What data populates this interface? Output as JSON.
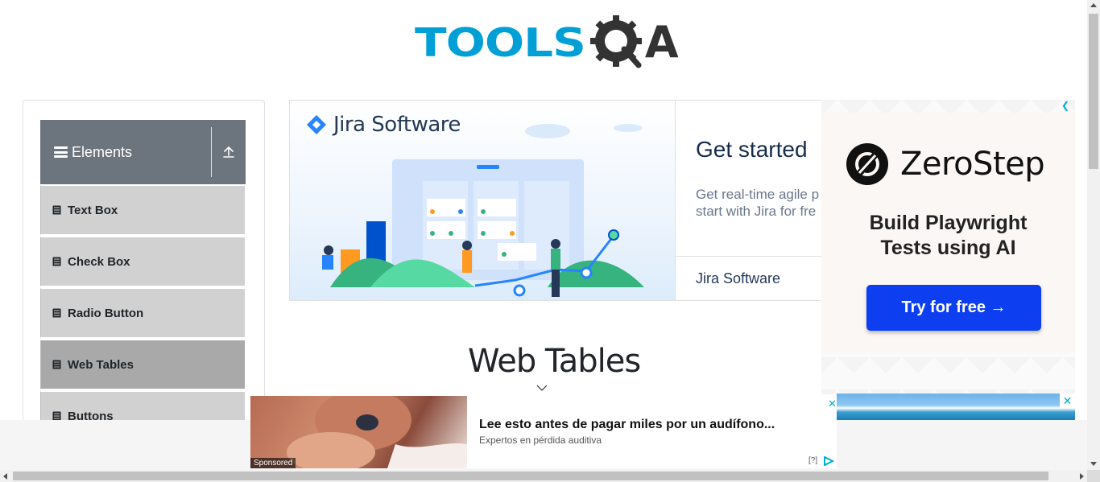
{
  "header": {
    "logo_text": "TOOLS",
    "logo_suffix": "A",
    "logo_icon": "gear-magnifier-icon"
  },
  "sidebar": {
    "group_title": "Elements",
    "group_icon": "hamburger-icon",
    "collapse_icon": "upload-arrow-icon",
    "items": [
      {
        "label": "Text Box",
        "icon": "file-icon"
      },
      {
        "label": "Check Box",
        "icon": "file-icon"
      },
      {
        "label": "Radio Button",
        "icon": "file-icon"
      },
      {
        "label": "Web Tables",
        "icon": "file-icon",
        "active": true
      },
      {
        "label": "Buttons",
        "icon": "file-icon"
      }
    ]
  },
  "ads": {
    "jira": {
      "brand": "Jira Software",
      "headline": "Get started",
      "sub_line1": "Get real-time agile p",
      "sub_line2": "start with Jira for fre",
      "footer": "Jira Software"
    },
    "zerostep": {
      "brand": "ZeroStep",
      "tagline_line1": "Build Playwright",
      "tagline_line2": "Tests using AI",
      "cta": "Try for free →"
    },
    "bottom": {
      "sponsored": "Sponsored",
      "title": "Lee esto antes de pagar miles por un audífono...",
      "subtitle": "Expertos en pérdida auditiva",
      "help": "[?]",
      "close": "✕"
    },
    "side_close": "✕",
    "top_choice": "❮"
  },
  "main": {
    "title": "Web Tables"
  },
  "colors": {
    "accent": "#00a0d6",
    "sidebar_header": "#6c757d",
    "menu_item": "#d1d1d1",
    "menu_active": "#a9a9a9",
    "cta": "#0d3ef0"
  }
}
